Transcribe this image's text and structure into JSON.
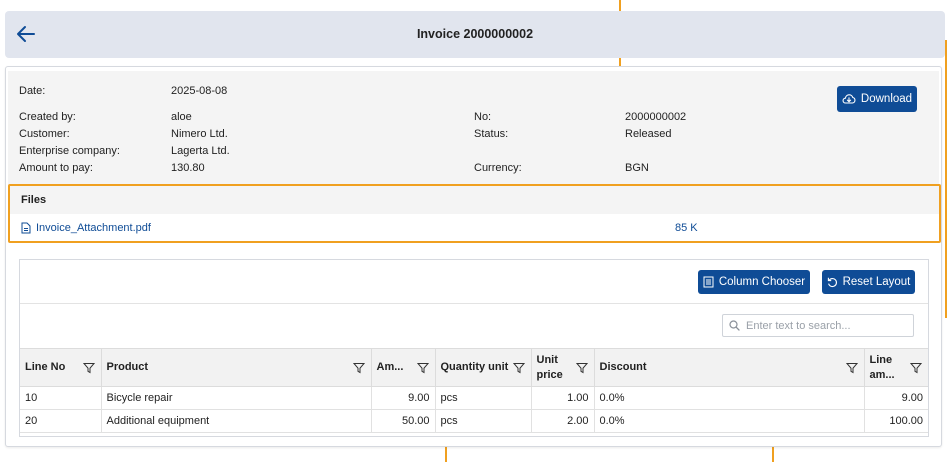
{
  "header": {
    "title": "Invoice 2000000002"
  },
  "details": {
    "date_label": "Date:",
    "date_value": "2025-08-08",
    "created_by_label": "Created by:",
    "created_by_value": "aloe",
    "customer_label": "Customer:",
    "customer_value": "Nimero Ltd.",
    "enterprise_label": "Enterprise company:",
    "enterprise_value": "Lagerta Ltd.",
    "amount_label": "Amount to pay:",
    "amount_value": "130.80",
    "no_label": "No:",
    "no_value": "2000000002",
    "status_label": "Status:",
    "status_value": "Released",
    "currency_label": "Currency:",
    "currency_value": "BGN"
  },
  "download_label": "Download",
  "files": {
    "title": "Files",
    "items": [
      {
        "name": "Invoice_Attachment.pdf",
        "size": "85 K"
      }
    ]
  },
  "grid": {
    "column_chooser_label": "Column Chooser",
    "reset_layout_label": "Reset Layout",
    "search_placeholder": "Enter text to search...",
    "columns": [
      "Line No",
      "Product",
      "Am...",
      "Quantity unit",
      "Unit price",
      "Discount",
      "Line am..."
    ],
    "rows": [
      [
        "10",
        "Bicycle repair",
        "9.00",
        "pcs",
        "1.00",
        "0.0%",
        "9.00"
      ],
      [
        "20",
        "Additional equipment",
        "50.00",
        "pcs",
        "2.00",
        "0.0%",
        "100.00"
      ]
    ]
  },
  "colors": {
    "accent": "#0f4c96",
    "highlight": "#f0a020",
    "header_bg": "#e1e5ee"
  },
  "icons": [
    "back-arrow-icon",
    "cloud-download-icon",
    "file-icon",
    "column-chooser-icon",
    "reset-icon",
    "search-icon",
    "filter-icon"
  ]
}
